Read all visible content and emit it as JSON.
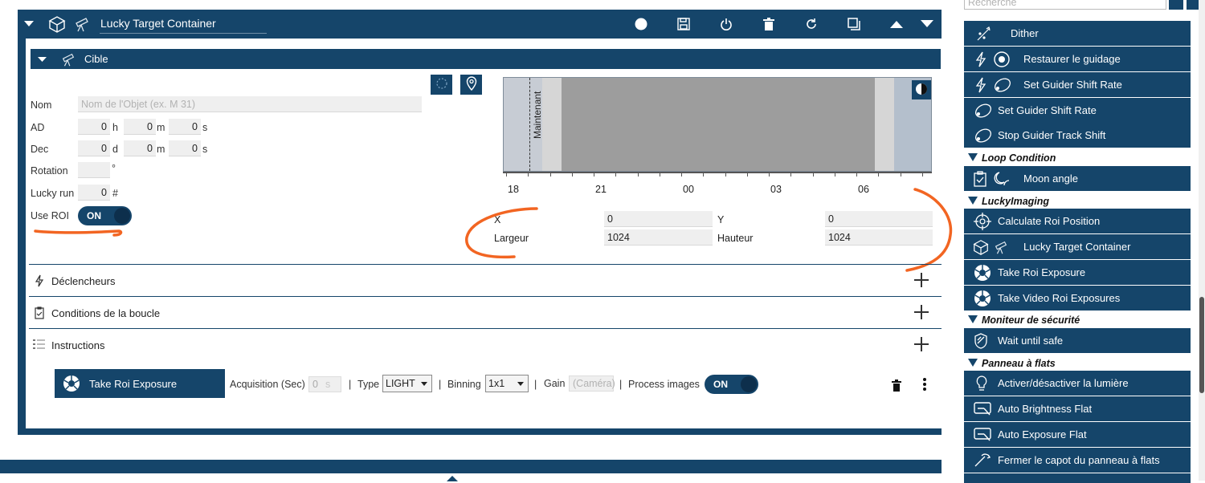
{
  "container": {
    "title": "Lucky Target Container"
  },
  "target": {
    "header": "Cible",
    "name_label": "Nom",
    "name_placeholder": "Nom de l'Objet (ex. M 31)",
    "ra_label": "AD",
    "ra": {
      "h": "0",
      "h_unit": "h",
      "m": "0",
      "m_unit": "m",
      "s": "0",
      "s_unit": "s"
    },
    "dec_label": "Dec",
    "dec": {
      "d": "0",
      "d_unit": "d",
      "m": "0",
      "m_unit": "m",
      "s": "0",
      "s_unit": "s"
    },
    "rotation_label": "Rotation",
    "rotation_value": "",
    "rotation_unit": "°",
    "lucky_run_label": "Lucky run",
    "lucky_run_value": "0",
    "lucky_run_unit": "#",
    "use_roi_label": "Use ROI",
    "use_roi_toggle": "ON"
  },
  "chart": {
    "now_label": "Maintenant",
    "ticks": [
      "18",
      "21",
      "00",
      "03",
      "06"
    ]
  },
  "roi": {
    "x_label": "X",
    "x_value": "0",
    "y_label": "Y",
    "y_value": "0",
    "width_label": "Largeur",
    "width_value": "1024",
    "height_label": "Hauteur",
    "height_value": "1024"
  },
  "sections": {
    "triggers": "Déclencheurs",
    "loop_conditions": "Conditions de la boucle",
    "instructions": "Instructions"
  },
  "instruction": {
    "name": "Take Roi Exposure",
    "exposure_label": "Acquisition (Sec)",
    "exposure_value": "0",
    "exposure_unit": "s",
    "sep": "|",
    "type_label": "Type",
    "type_value": "LIGHT",
    "binning_label": "Binning",
    "binning_value": "1x1",
    "gain_label": "Gain",
    "gain_placeholder": "(Caméra)",
    "process_label": "Process images",
    "process_toggle": "ON"
  },
  "sidebar": {
    "search_placeholder": "Recherche",
    "items": [
      {
        "label": "Dither"
      },
      {
        "label": "Restaurer le guidage"
      },
      {
        "label": "Set Guider Shift Rate"
      },
      {
        "label": "Set Guider Shift Rate"
      },
      {
        "label": "Stop Guider Track Shift"
      }
    ],
    "cat_loop": "Loop Condition",
    "loop_items": [
      {
        "label": "Moon angle"
      }
    ],
    "cat_lucky": "LuckyImaging",
    "lucky_items": [
      {
        "label": "Calculate Roi Position"
      },
      {
        "label": "Lucky Target Container"
      },
      {
        "label": "Take Roi Exposure"
      },
      {
        "label": "Take Video Roi Exposures"
      }
    ],
    "cat_safety": "Moniteur de sécurité",
    "safety_items": [
      {
        "label": "Wait until safe"
      }
    ],
    "cat_flats": "Panneau à flats",
    "flat_items": [
      {
        "label": "Activer/désactiver la lumière"
      },
      {
        "label": "Auto Brightness Flat"
      },
      {
        "label": "Auto Exposure Flat"
      },
      {
        "label": "Fermer le capot du panneau à flats"
      }
    ]
  },
  "colors": {
    "primary": "#15456a",
    "annotation": "#f26522"
  }
}
